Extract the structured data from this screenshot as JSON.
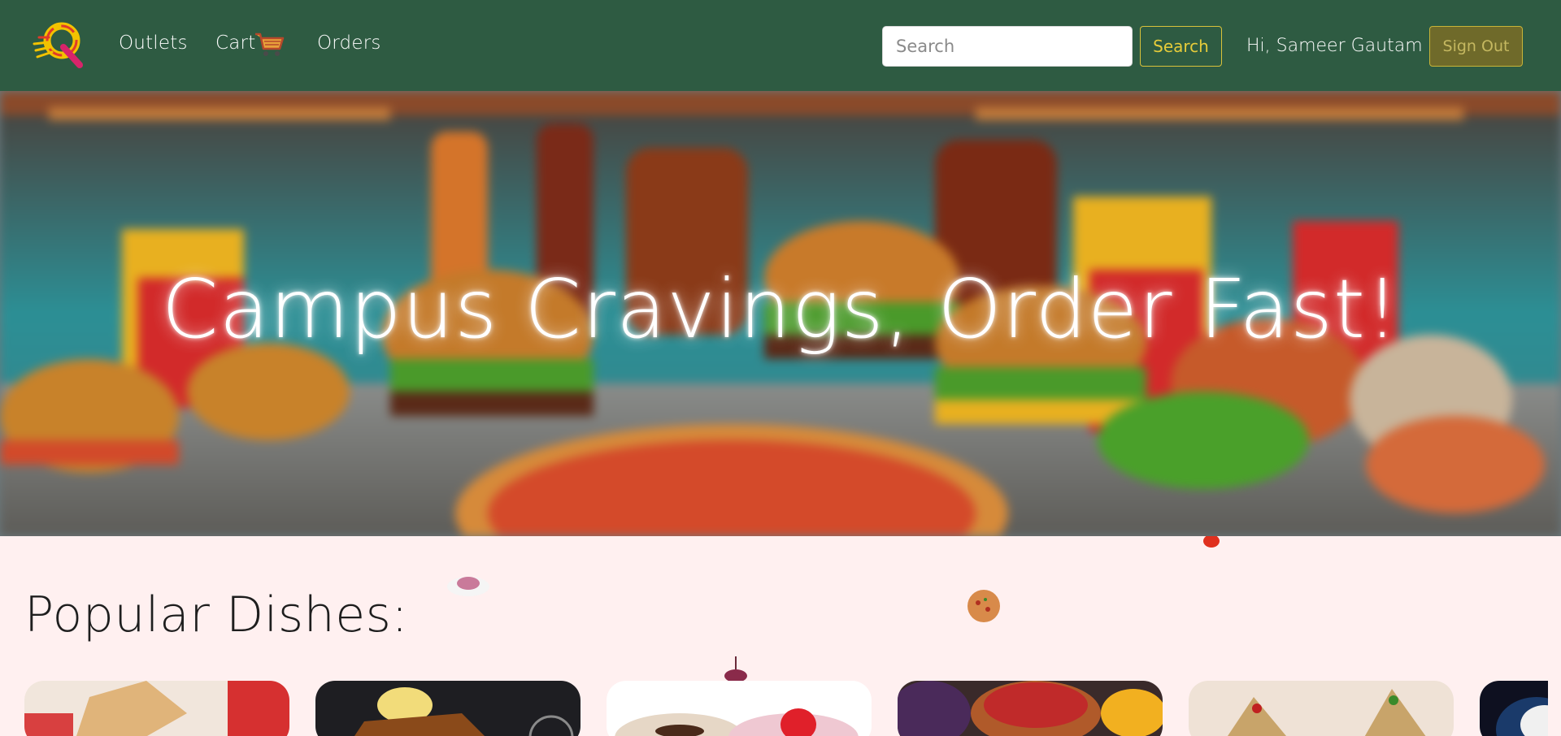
{
  "navbar": {
    "logo_icon": "brand-q-logo-icon",
    "links": [
      "Outlets",
      "Cart",
      "Orders"
    ],
    "cart_icon": "shopping-cart-icon",
    "search_placeholder": "Search",
    "search_button": "Search",
    "greeting": "Hi, Sameer Gautam",
    "signout_button": "Sign Out",
    "bg_color": "#2e5b42",
    "accent_color": "#e6cc3a"
  },
  "hero": {
    "title": "Campus Cravings, Order Fast!",
    "image": "blurred-fast-food-table"
  },
  "popular": {
    "title": "Popular Dishes:",
    "dishes": [
      {
        "icon": "sandwich-dish-image"
      },
      {
        "icon": "grilled-fish-dish-image"
      },
      {
        "icon": "milkshake-dish-image"
      },
      {
        "icon": "fruit-bowl-dish-image"
      },
      {
        "icon": "sushi-dish-image"
      },
      {
        "icon": "salad-dish-image"
      }
    ]
  }
}
